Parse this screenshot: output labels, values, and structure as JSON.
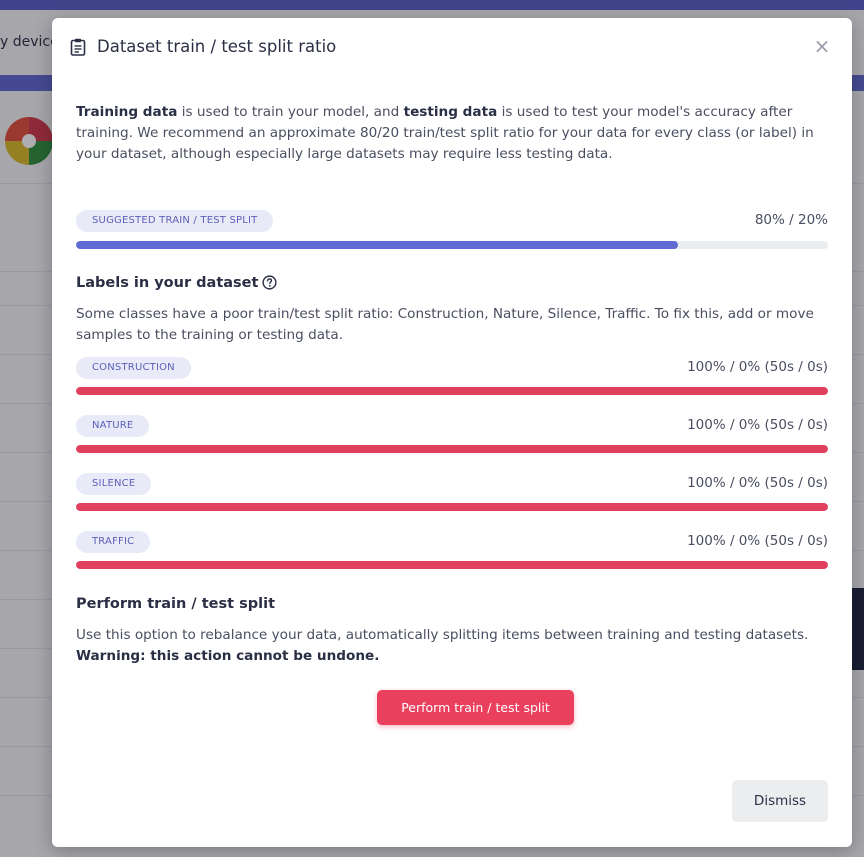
{
  "background": {
    "snippet_text": "y device c"
  },
  "modal": {
    "title": "Dataset train / test split ratio",
    "close_label": "×",
    "intro": {
      "part1_bold": "Training data",
      "part2": " is used to train your model, and ",
      "part3_bold": "testing data",
      "part4": " is used to test your model's accuracy after training. We recommend an approximate 80/20 train/test split ratio for your data for every class (or label) in your dataset, although especially large datasets may require less testing data."
    },
    "suggested": {
      "badge": "SUGGESTED TRAIN / TEST SPLIT",
      "ratio": "80% / 20%",
      "train_fraction": 0.8,
      "color": "#5f6bd3"
    },
    "labels_section": {
      "title": "Labels in your dataset",
      "help_icon": "question-circle-icon",
      "description": "Some classes have a poor train/test split ratio: Construction, Nature, Silence, Traffic. To fix this, add or move samples to the training or testing data.",
      "bar_color": "#e0405e",
      "items": [
        {
          "label": "CONSTRUCTION",
          "ratio": "100% / 0% (50s / 0s)",
          "train_fraction": 1.0
        },
        {
          "label": "NATURE",
          "ratio": "100% / 0% (50s / 0s)",
          "train_fraction": 1.0
        },
        {
          "label": "SILENCE",
          "ratio": "100% / 0% (50s / 0s)",
          "train_fraction": 1.0
        },
        {
          "label": "TRAFFIC",
          "ratio": "100% / 0% (50s / 0s)",
          "train_fraction": 1.0
        }
      ]
    },
    "perform_section": {
      "title": "Perform train / test split",
      "description": "Use this option to rebalance your data, automatically splitting items between training and testing datasets.",
      "warning": "Warning: this action cannot be undone.",
      "button_label": "Perform train / test split"
    },
    "dismiss_label": "Dismiss"
  }
}
